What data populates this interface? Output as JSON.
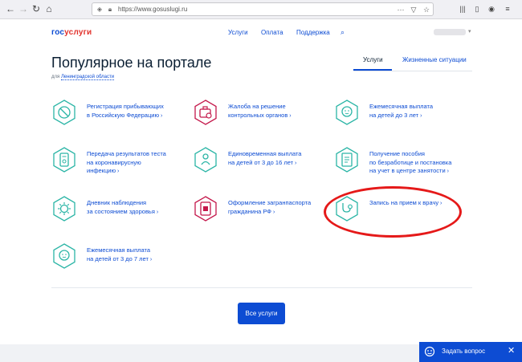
{
  "browser": {
    "url": "https://www.gosuslugi.ru",
    "icons": [
      "back-icon",
      "forward-icon",
      "reload-icon",
      "home-icon",
      "shield-icon",
      "lock-icon",
      "more-icon",
      "pocket-icon",
      "star-icon",
      "library-icon",
      "sidebar-icon",
      "account-icon",
      "menu-icon"
    ]
  },
  "header": {
    "logo_part1": "гос",
    "logo_part2": "услуги",
    "nav": [
      "Услуги",
      "Оплата",
      "Поддержка"
    ]
  },
  "main": {
    "title": "Популярное на портале",
    "region_prefix": "для",
    "region_name": "Ленинградской области",
    "tabs": [
      {
        "label": "Услуги",
        "active": true
      },
      {
        "label": "Жизненные ситуации",
        "active": false
      }
    ],
    "services": [
      {
        "line1": "Регистрация прибывающих",
        "line2": "в Российскую Федерацию",
        "line3": "",
        "icon": "no-entry-icon",
        "color": "#2bb5a6"
      },
      {
        "line1": "Жалоба на решение",
        "line2": "контрольных органов",
        "line3": "",
        "icon": "briefcase-search-icon",
        "color": "#c4184b"
      },
      {
        "line1": "Ежемесячная выплата",
        "line2": "на детей до 3 лет",
        "line3": "",
        "icon": "baby-icon",
        "color": "#2bb5a6"
      },
      {
        "line1": "Передача результатов теста",
        "line2": "на коронавирусную",
        "line3": "инфекцию",
        "icon": "test-tube-icon",
        "color": "#2bb5a6"
      },
      {
        "line1": "Единовременная выплата",
        "line2": "на детей от 3 до 16 лет",
        "line3": "",
        "icon": "child-icon",
        "color": "#2bb5a6"
      },
      {
        "line1": "Получение пособия",
        "line2": "по безработице и постановка",
        "line3": "на учет в центре занятости",
        "icon": "document-icon",
        "color": "#2bb5a6"
      },
      {
        "line1": "Дневник наблюдения",
        "line2": "за состоянием здоровья",
        "line3": "",
        "icon": "virus-icon",
        "color": "#2bb5a6"
      },
      {
        "line1": "Оформление загранпаспорта",
        "line2": "гражданина РФ",
        "line3": "",
        "icon": "passport-icon",
        "color": "#c4184b"
      },
      {
        "line1": "Запись на прием к врачу",
        "line2": "",
        "line3": "",
        "icon": "stethoscope-icon",
        "color": "#2bb5a6"
      },
      {
        "line1": "Ежемесячная выплата",
        "line2": "на детей от 3 до 7 лет",
        "line3": "",
        "icon": "toddler-icon",
        "color": "#2bb5a6"
      }
    ],
    "chevron": "›",
    "all_services_button": "Все услуги"
  },
  "chat": {
    "label": "Задать вопрос",
    "close": "✕"
  },
  "colors": {
    "brand_blue": "#0d4cd3",
    "brand_red": "#e2322c",
    "teal": "#2bb5a6",
    "crimson": "#c4184b",
    "highlight_red": "#e51919"
  }
}
